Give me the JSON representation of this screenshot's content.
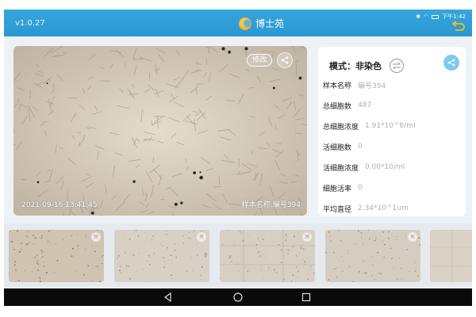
{
  "header": {
    "version": "v1.0.27",
    "brand": "博士苑",
    "status_text": "下午1:42"
  },
  "main_image": {
    "edit_label": "修改",
    "timestamp": "2021-09-16 13:41:45",
    "sample_name_overlay": "样本名称:编号394"
  },
  "panel": {
    "mode": "模式：非染色",
    "fields": [
      {
        "key": "样本名称",
        "value": "编号394"
      },
      {
        "key": "总细胞数",
        "value": "487"
      },
      {
        "key": "总细胞浓度",
        "value": "1.91*10^6/ml"
      },
      {
        "key": "活细胞数",
        "value": "0"
      },
      {
        "key": "活细胞浓度",
        "value": "0.00*10/ml"
      },
      {
        "key": "细胞活率",
        "value": "0"
      },
      {
        "key": "平均直径",
        "value": "2.34*10^1um"
      }
    ]
  },
  "thumbnails": [
    {
      "id": "t1",
      "close_icon": "×"
    },
    {
      "id": "t2",
      "close_icon": "×"
    },
    {
      "id": "t3",
      "close_icon": "×"
    },
    {
      "id": "t4",
      "close_icon": "×"
    },
    {
      "id": "t5",
      "close_icon": "×"
    }
  ],
  "colors": {
    "header": "#2f9fd8",
    "panel_share": "#7fc8ef",
    "muted_value": "#aab0b6"
  },
  "icons": {
    "back": "back-arrow-icon",
    "share": "share-icon",
    "switch": "switch-arrows-icon",
    "nav_back": "triangle-back-icon",
    "nav_home": "circle-home-icon",
    "nav_recent": "square-recent-icon"
  }
}
